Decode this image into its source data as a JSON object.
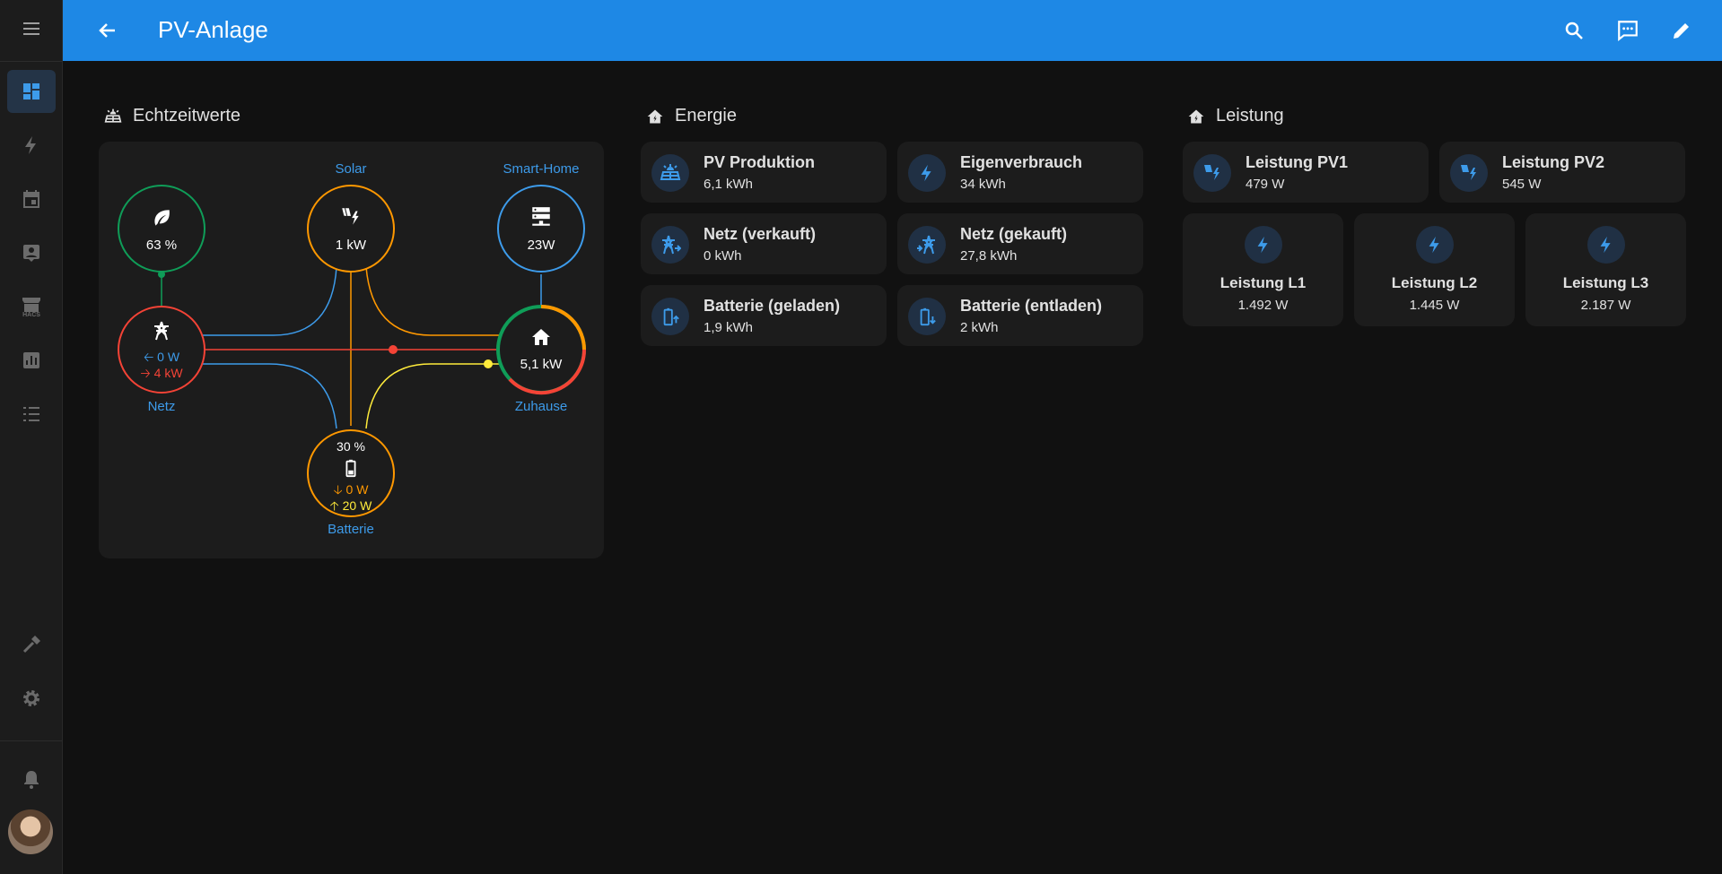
{
  "app": {
    "title": "PV-Anlage",
    "colors": {
      "accent": "#1e88e5",
      "icon_blue": "#3d9bea",
      "solar": "#ff9800",
      "grid_in": "#f44336",
      "battery": "#ffeb3b",
      "low_carbon": "#0f9d58",
      "background": "#111111",
      "card": "#1c1c1c"
    }
  },
  "sidebar": {
    "items": [
      {
        "name": "menu",
        "icon": "menu-icon"
      },
      {
        "name": "overview",
        "icon": "dashboard-icon",
        "active": true
      },
      {
        "name": "energy",
        "icon": "lightning-icon"
      },
      {
        "name": "calendar",
        "icon": "calendar-icon"
      },
      {
        "name": "logbook",
        "icon": "account-box-icon"
      },
      {
        "name": "hacs",
        "icon": "store-icon",
        "text": "HACS"
      },
      {
        "name": "history",
        "icon": "chart-icon"
      },
      {
        "name": "todo",
        "icon": "list-icon"
      },
      {
        "name": "developer-tools",
        "icon": "hammer-icon"
      },
      {
        "name": "settings",
        "icon": "gear-icon"
      },
      {
        "name": "notifications",
        "icon": "bell-icon"
      },
      {
        "name": "profile",
        "icon": "avatar"
      }
    ]
  },
  "topbar": {
    "icons": [
      "back-arrow-icon",
      "search-icon",
      "assist-icon",
      "pencil-icon"
    ]
  },
  "columns": {
    "realtime": {
      "title": "Echtzeitwerte",
      "icon": "solar-panel-icon"
    },
    "energy": {
      "title": "Energie",
      "icon": "home-lightning-icon"
    },
    "power": {
      "title": "Leistung",
      "icon": "home-lightning-icon"
    }
  },
  "flow": {
    "low_carbon": {
      "value": "63 %",
      "icon": "leaf-icon"
    },
    "solar": {
      "label": "Solar",
      "value": "1 kW",
      "icon": "solar-power-icon"
    },
    "smarthome": {
      "label": "Smart-Home",
      "value": "23W",
      "icon": "server-icon"
    },
    "grid": {
      "label": "Netz",
      "return": "0 W",
      "consumption": "4 kW",
      "return_arrow": "🡠",
      "consumption_arrow": "🡢",
      "icon": "transmission-tower-icon"
    },
    "home": {
      "label": "Zuhause",
      "value": "5,1 kW",
      "icon": "home-icon"
    },
    "battery": {
      "label": "Batterie",
      "soc": "30 %",
      "in": "0 W",
      "out": "20 W",
      "in_arrow": "🡣",
      "out_arrow": "🡡",
      "icon": "battery-icon"
    }
  },
  "energy_tiles": [
    {
      "name": "PV Produktion",
      "value": "6,1 kWh",
      "icon": "solar-panel-icon"
    },
    {
      "name": "Eigenverbrauch",
      "value": "34 kWh",
      "icon": "lightning-icon"
    },
    {
      "name": "Netz (verkauft)",
      "value": "0 kWh",
      "icon": "transmission-tower-export-icon"
    },
    {
      "name": "Netz (gekauft)",
      "value": "27,8 kWh",
      "icon": "transmission-tower-import-icon"
    },
    {
      "name": "Batterie (geladen)",
      "value": "1,9 kWh",
      "icon": "battery-arrow-up-icon"
    },
    {
      "name": "Batterie (entladen)",
      "value": "2 kWh",
      "icon": "battery-arrow-down-icon"
    }
  ],
  "power_tiles": [
    {
      "name": "Leistung PV1",
      "value": "479 W",
      "icon": "solar-power-icon"
    },
    {
      "name": "Leistung PV2",
      "value": "545 W",
      "icon": "solar-power-icon"
    }
  ],
  "phase_tiles": [
    {
      "name": "Leistung L1",
      "value": "1.492 W",
      "icon": "lightning-icon"
    },
    {
      "name": "Leistung L2",
      "value": "1.445 W",
      "icon": "lightning-icon"
    },
    {
      "name": "Leistung L3",
      "value": "2.187 W",
      "icon": "lightning-icon"
    }
  ]
}
